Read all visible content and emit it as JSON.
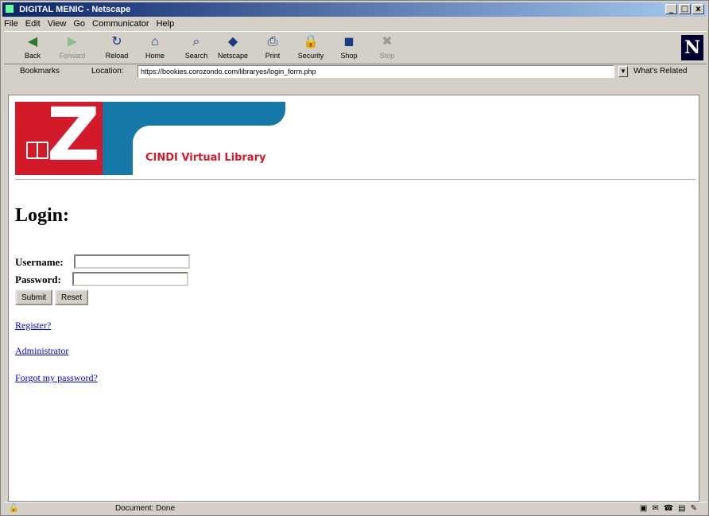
{
  "window": {
    "title": "DIGITAL MENIC - Netscape",
    "controls": {
      "minimize": "_",
      "maximize": "□",
      "close": "x"
    }
  },
  "menu": [
    "File",
    "Edit",
    "View",
    "Go",
    "Communicator",
    "Help"
  ],
  "toolbar": [
    {
      "label": "Back",
      "icon": "back-arrow-icon",
      "glyph": "◀"
    },
    {
      "label": "Forward",
      "icon": "forward-arrow-icon",
      "glyph": "▶"
    },
    {
      "label": "Reload",
      "icon": "reload-icon",
      "glyph": "↻"
    },
    {
      "label": "Home",
      "icon": "home-icon",
      "glyph": "⌂"
    },
    {
      "label": "Search",
      "icon": "search-icon",
      "glyph": "⌕"
    },
    {
      "label": "Netscape",
      "icon": "netscape-icon",
      "glyph": "◆"
    },
    {
      "label": "Print",
      "icon": "print-icon",
      "glyph": "⎙"
    },
    {
      "label": "Security",
      "icon": "security-lock-icon",
      "glyph": "🔒"
    },
    {
      "label": "Shop",
      "icon": "shop-icon",
      "glyph": "◼"
    },
    {
      "label": "Stop",
      "icon": "stop-icon",
      "glyph": "✖"
    }
  ],
  "location": {
    "bookmarks_label": "Bookmarks",
    "location_label": "Location:",
    "url": "https://bookies.corozondo.com/libraryes/login_form.php",
    "whats_related": "What's Related"
  },
  "page": {
    "site_name": "CINDI Virtual Library",
    "logo_letter": "Z",
    "heading": "Login:",
    "username_label": "Username:",
    "username_value": "",
    "password_label": "Password:",
    "password_value": "",
    "submit_label": "Submit",
    "reset_label": "Reset",
    "links": [
      "Register?",
      "Administrator",
      "Forgot my password?"
    ]
  },
  "status": {
    "message": "Document: Done"
  },
  "colors": {
    "brand_red": "#d21a2a",
    "brand_blue": "#1478a8",
    "link": "#0000ee"
  }
}
